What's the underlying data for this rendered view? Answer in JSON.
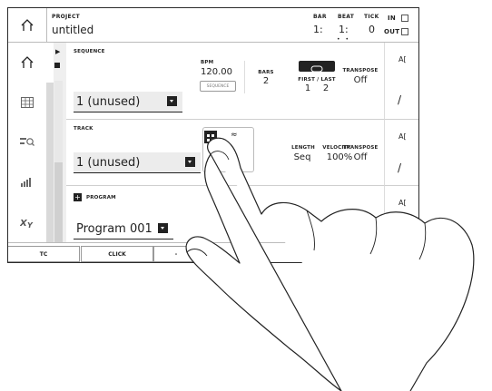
{
  "header": {
    "project_label": "PROJECT",
    "project_name": "untitled",
    "bar_label": "BAR",
    "beat_label": "BEAT",
    "tick_label": "TICK",
    "bar_value": "1:",
    "beat_value": "1:",
    "tick_value": "0",
    "dots": "• •",
    "in_label": "IN",
    "out_label": "OUT"
  },
  "sidebar": {
    "icons": [
      "home-icon",
      "grid-icon",
      "search-list-icon",
      "level-bars-icon",
      "xy-icon"
    ]
  },
  "sequence": {
    "label": "SEQUENCE",
    "selected": "1  (unused)",
    "bpm_label": "BPM",
    "bpm_value": "120.00",
    "bpm_button": "SEQUENCE",
    "bars_label": "BARS",
    "bars_value": "2",
    "first_last_label": "FIRST / LAST",
    "first_value": "1",
    "last_value": "2",
    "transpose_label": "TRANSPOSE",
    "transpose_value": "Off"
  },
  "track": {
    "label": "TRACK",
    "selected": "1  (unused)",
    "length_label": "LENGTH",
    "length_value": "Seq",
    "velocity_label": "VELOCITY",
    "velocity_value": "100%",
    "transpose_label": "TRANSPOSE",
    "transpose_value": "Off"
  },
  "program": {
    "label": "PROGRAM",
    "add_symbol": "+",
    "selected": "Program 001"
  },
  "side_controls": {
    "ai_label": "A[",
    "pencil": "/"
  },
  "bottom": {
    "tc_label": "TC",
    "click_label": "CLICK",
    "minus_label": "-"
  }
}
